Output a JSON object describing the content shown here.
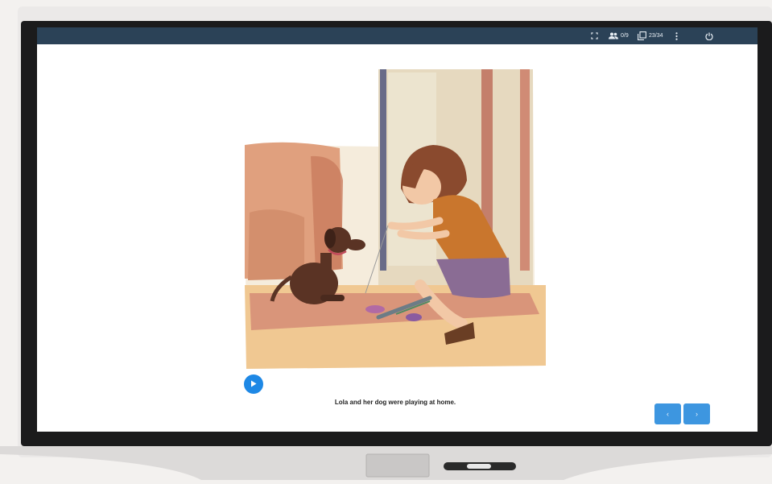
{
  "topbar": {
    "participants_count": "0/9",
    "page_counter": "23/34",
    "icons": [
      "fullscreen-icon",
      "participants-icon",
      "pages-icon",
      "more-vert-icon",
      "power-icon"
    ]
  },
  "story": {
    "caption": "Lola and her dog were playing at home."
  },
  "navigation": {
    "prev_label": "‹",
    "next_label": "›"
  },
  "colors": {
    "topbar": "#2b4257",
    "accent": "#1e88e5",
    "nav_button": "#3d96e0"
  }
}
